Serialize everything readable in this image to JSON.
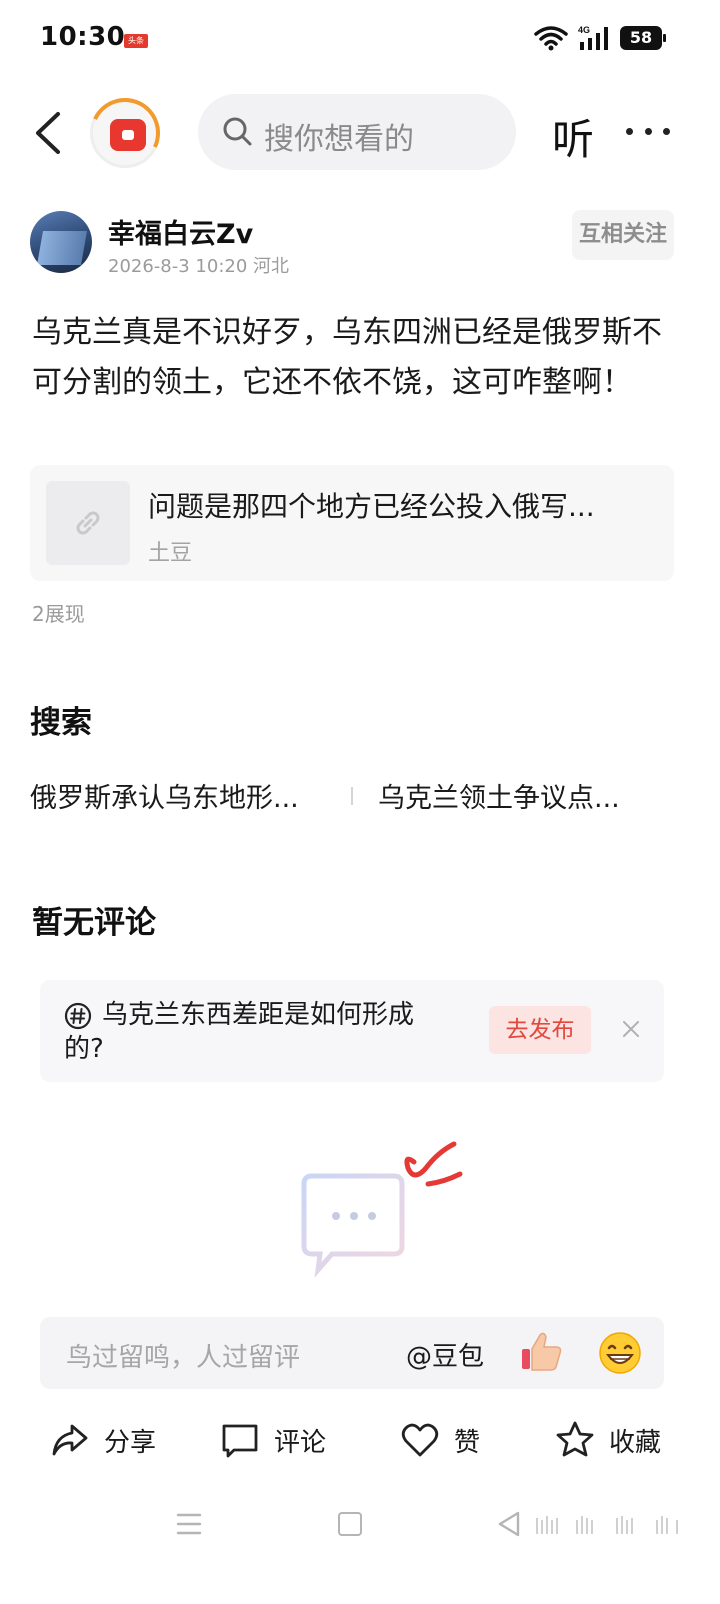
{
  "status_bar": {
    "time": "10:30",
    "app_badge": "头条",
    "network": "4G",
    "battery": "58"
  },
  "nav": {
    "search_placeholder": "搜你想看的",
    "listen_label": "听"
  },
  "author": {
    "name": "幸福白云Zv",
    "meta": "2026-8-3 10:20  河北",
    "follow_label": "互相关注"
  },
  "post": {
    "text": "乌克兰真是不识好歹，乌东四洲已经是俄罗斯不可分割的领土，它还不依不饶，这可咋整啊！",
    "link_card": {
      "title": "问题是那四个地方已经公投入俄写...",
      "source": "土豆"
    },
    "views": "2展现"
  },
  "search_section": {
    "heading": "搜索",
    "suggestions": [
      "俄罗斯承认乌东地形...",
      "乌克兰领土争议点..."
    ]
  },
  "comments": {
    "heading": "暂无评论",
    "topic": {
      "text": "乌克兰东西差距是如何形成的?",
      "publish_label": "去发布"
    },
    "input": {
      "placeholder": "鸟过留鸣，人过留评",
      "mention_label": "@豆包"
    }
  },
  "actions": {
    "share": "分享",
    "comment": "评论",
    "like": "赞",
    "favorite": "收藏"
  },
  "icons": {
    "back": "chevron-left-icon",
    "search": "search-icon",
    "more": "more-dots-icon",
    "link": "link-icon",
    "hash": "hashtag-icon",
    "close": "close-icon",
    "thumb": "thumbs-up-emoji-icon",
    "grin": "grin-emoji-icon"
  },
  "colors": {
    "accent_red": "#e8372f",
    "publish_text": "#e2483c",
    "publish_bg": "#fbe4e2",
    "ring_orange": "#f39a2c"
  }
}
